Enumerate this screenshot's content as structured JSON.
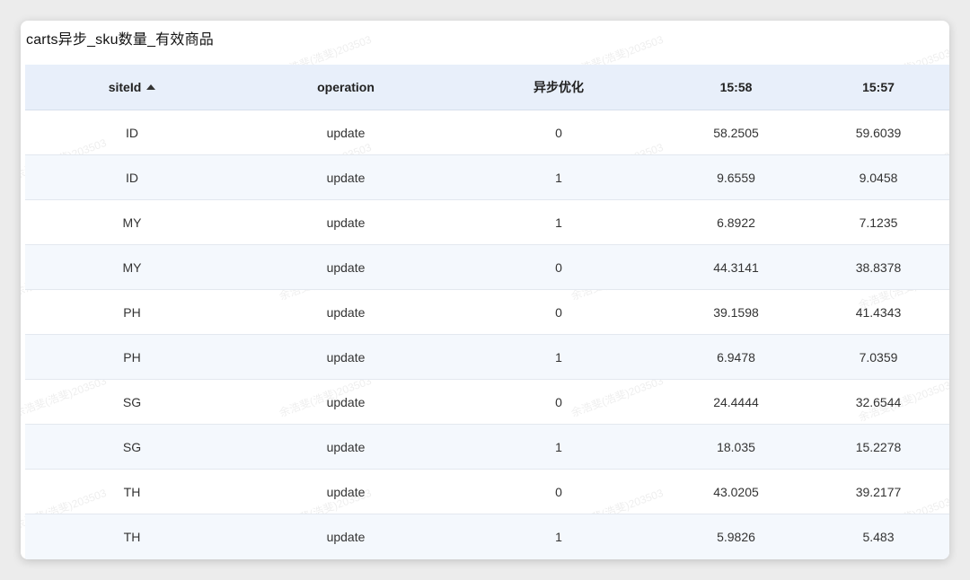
{
  "title": "carts异步_sku数量_有效商品",
  "table": {
    "columns": [
      {
        "label": "siteId",
        "sort": "asc"
      },
      {
        "label": "operation"
      },
      {
        "label": "异步优化"
      },
      {
        "label": "15:58"
      },
      {
        "label": "15:57"
      }
    ],
    "rows": [
      [
        "ID",
        "update",
        "0",
        "58.2505",
        "59.6039"
      ],
      [
        "ID",
        "update",
        "1",
        "9.6559",
        "9.0458"
      ],
      [
        "MY",
        "update",
        "1",
        "6.8922",
        "7.1235"
      ],
      [
        "MY",
        "update",
        "0",
        "44.3141",
        "38.8378"
      ],
      [
        "PH",
        "update",
        "0",
        "39.1598",
        "41.4343"
      ],
      [
        "PH",
        "update",
        "1",
        "6.9478",
        "7.0359"
      ],
      [
        "SG",
        "update",
        "0",
        "24.4444",
        "32.6544"
      ],
      [
        "SG",
        "update",
        "1",
        "18.035",
        "15.2278"
      ],
      [
        "TH",
        "update",
        "0",
        "43.0205",
        "39.2177"
      ],
      [
        "TH",
        "update",
        "1",
        "5.9826",
        "5.483"
      ]
    ]
  },
  "watermark": "余浩斐(浩斐)203503",
  "colors": {
    "header_bg": "#e8effa",
    "alt_row_bg": "#f4f8fd",
    "border": "#e3e8ef"
  }
}
